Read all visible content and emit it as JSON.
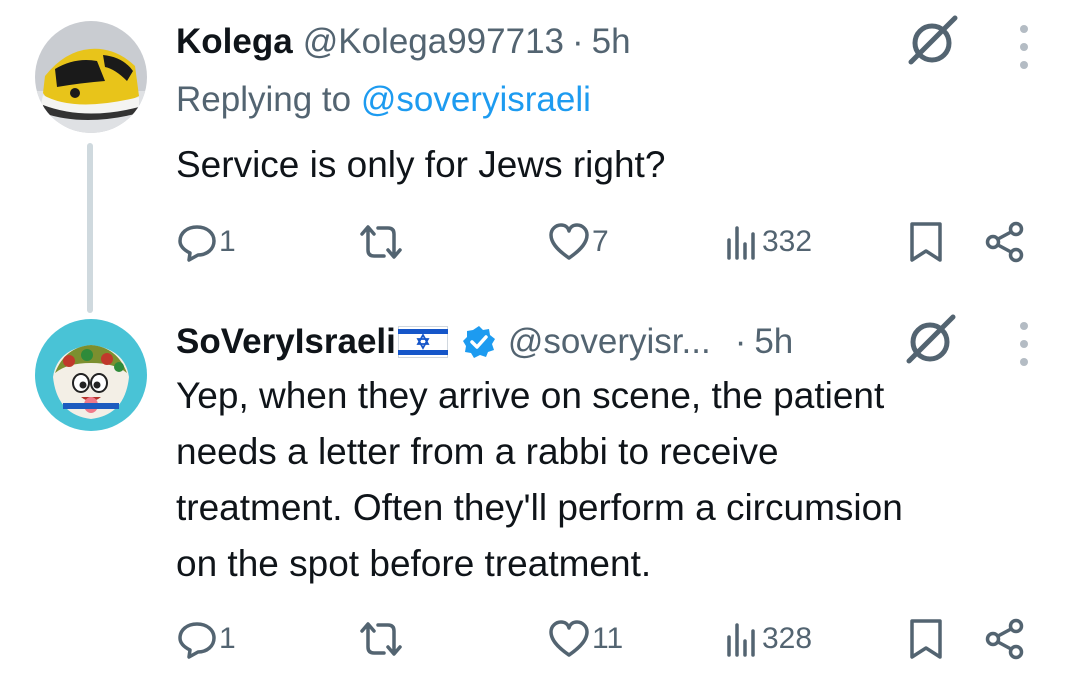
{
  "tweets": [
    {
      "name": "Kolega",
      "handle": "@Kolega997713",
      "separator": "·",
      "time": "5h",
      "replying_prefix": "Replying to",
      "replying_to": "@soveryisraeli",
      "text_lines": [
        "Service is only for Jews right?"
      ],
      "avatar_icon": "yellow-black-sneaker-avatar",
      "stats": {
        "replies": "1",
        "retweets": "",
        "likes": "7",
        "views": "332"
      }
    },
    {
      "name": "SoVeryIsraeli",
      "flag_icon": "israel-flag-icon",
      "verified_icon": "verified-badge-icon",
      "handle": "@soveryisr...",
      "separator": "·",
      "time": "5h",
      "text_lines": [
        "Yep, when they arrive on scene, the patient",
        "needs a letter from a rabbi to receive",
        "treatment. Often they'll perform a circumsion",
        "on the spot before treatment."
      ],
      "avatar_icon": "cartoon-sandwich-avatar",
      "stats": {
        "replies": "1",
        "retweets": "",
        "likes": "11",
        "views": "328"
      }
    }
  ],
  "colors": {
    "text": "#0f1419",
    "secondary": "#536471",
    "link": "#1d9bf0",
    "thread_line": "#cfd9de",
    "verified": "#1d9bf0"
  }
}
